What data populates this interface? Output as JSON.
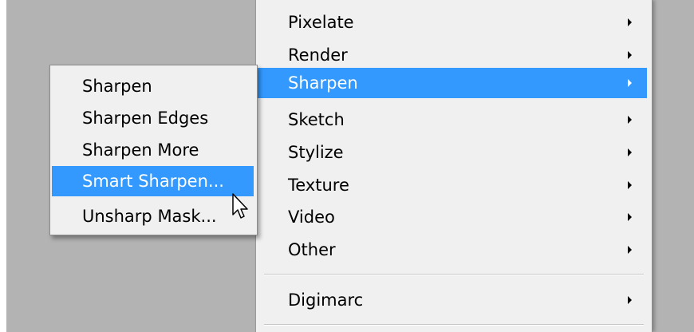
{
  "menu": {
    "items": [
      {
        "label": "Pixelate",
        "has_submenu": true
      },
      {
        "label": "Render",
        "has_submenu": true
      },
      {
        "label": "Sharpen",
        "has_submenu": true,
        "highlighted": true
      },
      {
        "label": "Sketch",
        "has_submenu": true
      },
      {
        "label": "Stylize",
        "has_submenu": true
      },
      {
        "label": "Texture",
        "has_submenu": true
      },
      {
        "label": "Video",
        "has_submenu": true
      },
      {
        "label": "Other",
        "has_submenu": true
      },
      {
        "label": "Digimarc",
        "has_submenu": true
      }
    ]
  },
  "submenu": {
    "items": [
      {
        "label": "Sharpen"
      },
      {
        "label": "Sharpen Edges"
      },
      {
        "label": "Sharpen More"
      },
      {
        "label": "Smart Sharpen...",
        "highlighted": true
      },
      {
        "label": "Unsharp Mask..."
      }
    ]
  },
  "colors": {
    "highlight": "#3399ff",
    "menu_background": "#f0f0f0",
    "canvas_background": "#b3b3b3"
  },
  "icons": {
    "submenu_arrow": "triangle-right-icon",
    "cursor": "arrow-pointer-icon"
  }
}
